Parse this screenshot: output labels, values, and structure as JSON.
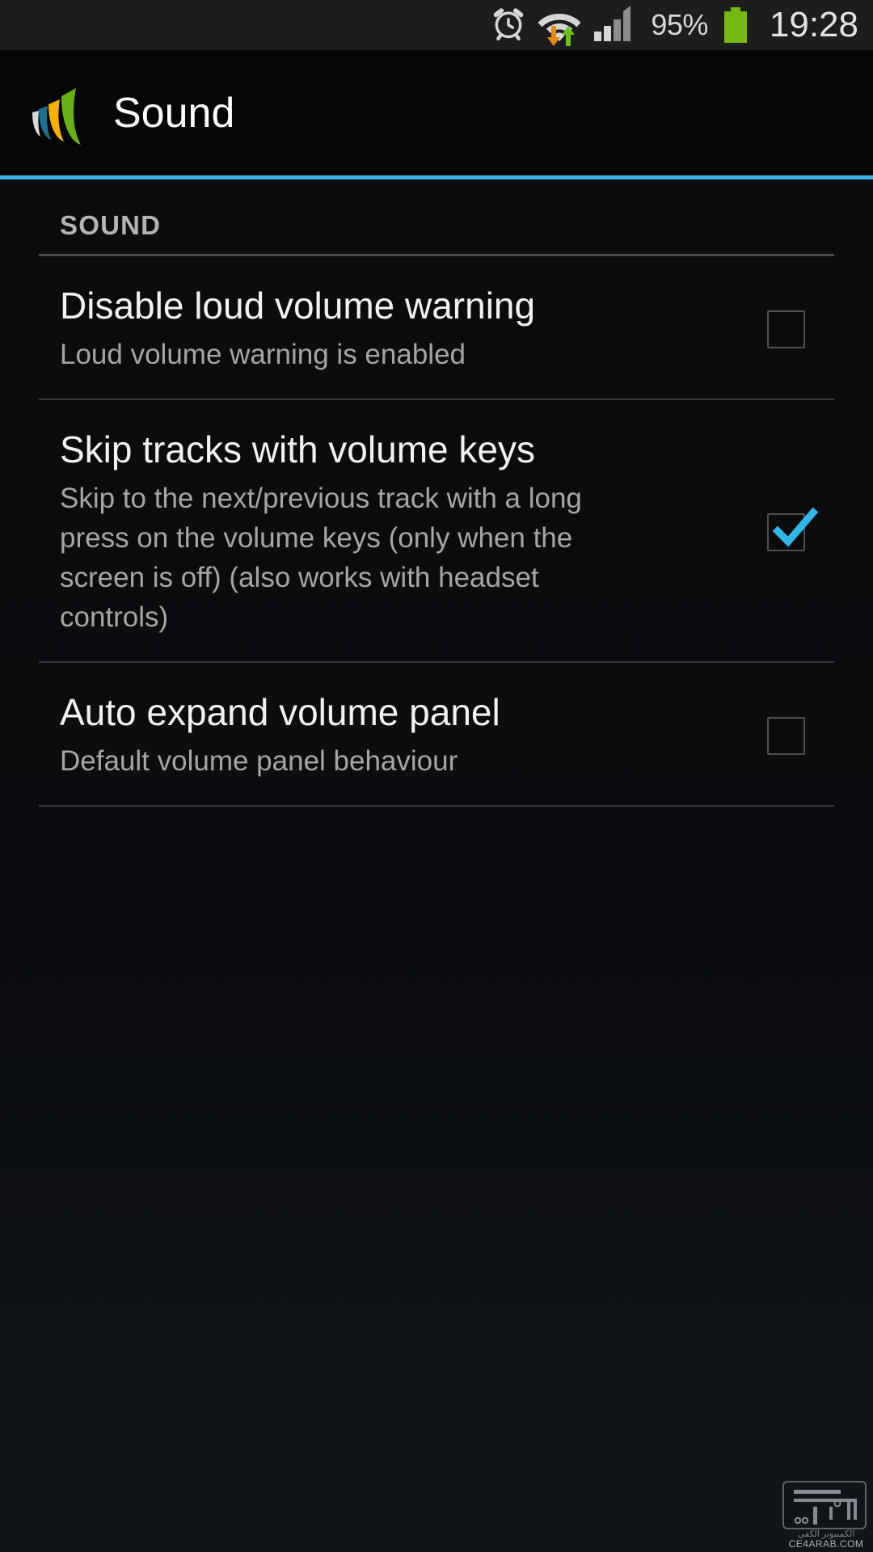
{
  "status_bar": {
    "icons": [
      "alarm-icon",
      "wifi-icon",
      "signal-icon",
      "battery-icon"
    ],
    "battery_percent": "95%",
    "time": "19:28"
  },
  "action_bar": {
    "app_icon": "w-logo-icon",
    "title": "Sound"
  },
  "accent_color": "#35b3e2",
  "content": {
    "section_title": "SOUND",
    "preferences": [
      {
        "title": "Disable loud volume warning",
        "summary": "Loud volume warning is enabled",
        "checked": false,
        "widget": "checkbox"
      },
      {
        "title": "Skip tracks with volume keys",
        "summary": "Skip to the next/previous track with a long press on the volume keys (only when the screen is off) (also works with headset controls)",
        "checked": true,
        "widget": "checkbox"
      },
      {
        "title": "Auto expand volume panel",
        "summary": "Default volume panel behaviour",
        "checked": false,
        "widget": "checkbox"
      }
    ]
  },
  "watermark": {
    "arabic": "الكمبيوتر الكفي",
    "domain": "CE4ARAB.COM"
  }
}
